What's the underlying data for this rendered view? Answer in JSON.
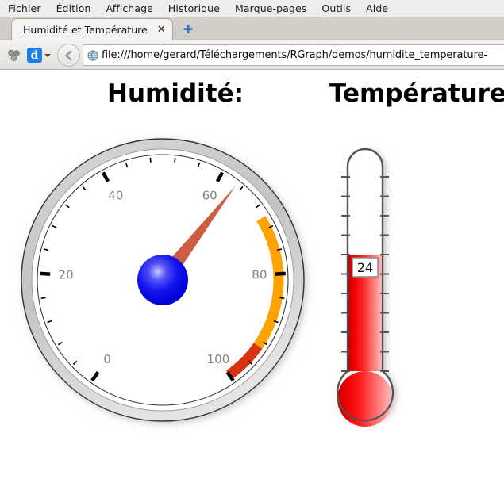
{
  "browser": {
    "menubar": [
      {
        "name": "fichier",
        "pre": "F",
        "mn": "",
        "post": "ichier",
        "full": "Fichier"
      },
      {
        "name": "edition",
        "pre": "Éditio",
        "mn": "n",
        "post": "",
        "full": "Édition"
      },
      {
        "name": "affichage",
        "pre": "A",
        "mn": "",
        "post": "ffichage",
        "full": "Affichage"
      },
      {
        "name": "historique",
        "pre": "H",
        "mn": "",
        "post": "istorique",
        "full": "Historique"
      },
      {
        "name": "marque-pages",
        "pre": "M",
        "mn": "",
        "post": "arque-pages",
        "full": "Marque-pages"
      },
      {
        "name": "outils",
        "pre": "O",
        "mn": "",
        "post": "utils",
        "full": "Outils"
      },
      {
        "name": "aide",
        "pre": "Aid",
        "mn": "e",
        "post": "",
        "full": "Aide"
      }
    ],
    "tab": {
      "title": "Humidité et Température",
      "close_label": "✕",
      "newtab_label": "✚"
    },
    "toolbar": {
      "addons_icon": "puzzle-icon",
      "downloads_badge": "d",
      "back_label": "←",
      "site_icon": "globe-icon"
    },
    "url": "file:///home/gerard/Téléchargements/RGraph/demos/humidite_temperature-"
  },
  "page": {
    "humidity_heading": "Humidité:",
    "temperature_heading": "Température:"
  },
  "chart_data": [
    {
      "type": "gauge",
      "name": "humidity-gauge",
      "title": "Humidité:",
      "value": 63,
      "min": 0,
      "max": 100,
      "tick_labels": [
        "0",
        "20",
        "40",
        "60",
        "80",
        "100"
      ],
      "tick_values": [
        0,
        20,
        40,
        60,
        80,
        100
      ],
      "angle_start_deg": 125,
      "angle_end_deg": 415,
      "minor_ticks_per_major": 5,
      "colors": {
        "needle": "#cc5c43",
        "centre_pin": "#1414f0",
        "rim_outer": "#c6c6c6",
        "face": "#ffffff",
        "tick": "#000000",
        "label": "#808080",
        "band_orange": "#ffa300",
        "band_red": "#d6330f"
      },
      "bands": [
        {
          "from": 70,
          "to": 93,
          "color": "#ffa300"
        },
        {
          "from": 93,
          "to": 100,
          "color": "#d6330f"
        }
      ]
    },
    {
      "type": "thermometer",
      "name": "temperature-thermometer",
      "title": "Température:",
      "value": 24,
      "value_label": "24",
      "min": 0,
      "max": 40,
      "scale_ticks": 11,
      "colors": {
        "mercury_dark": "#cc0000",
        "mercury_bright": "#ff1111",
        "mercury_light": "#ffb3b3",
        "outline": "#555555",
        "empty": "#ffffff",
        "label_box_bg": "#ffffff",
        "label_box_border": "#888888"
      }
    }
  ]
}
